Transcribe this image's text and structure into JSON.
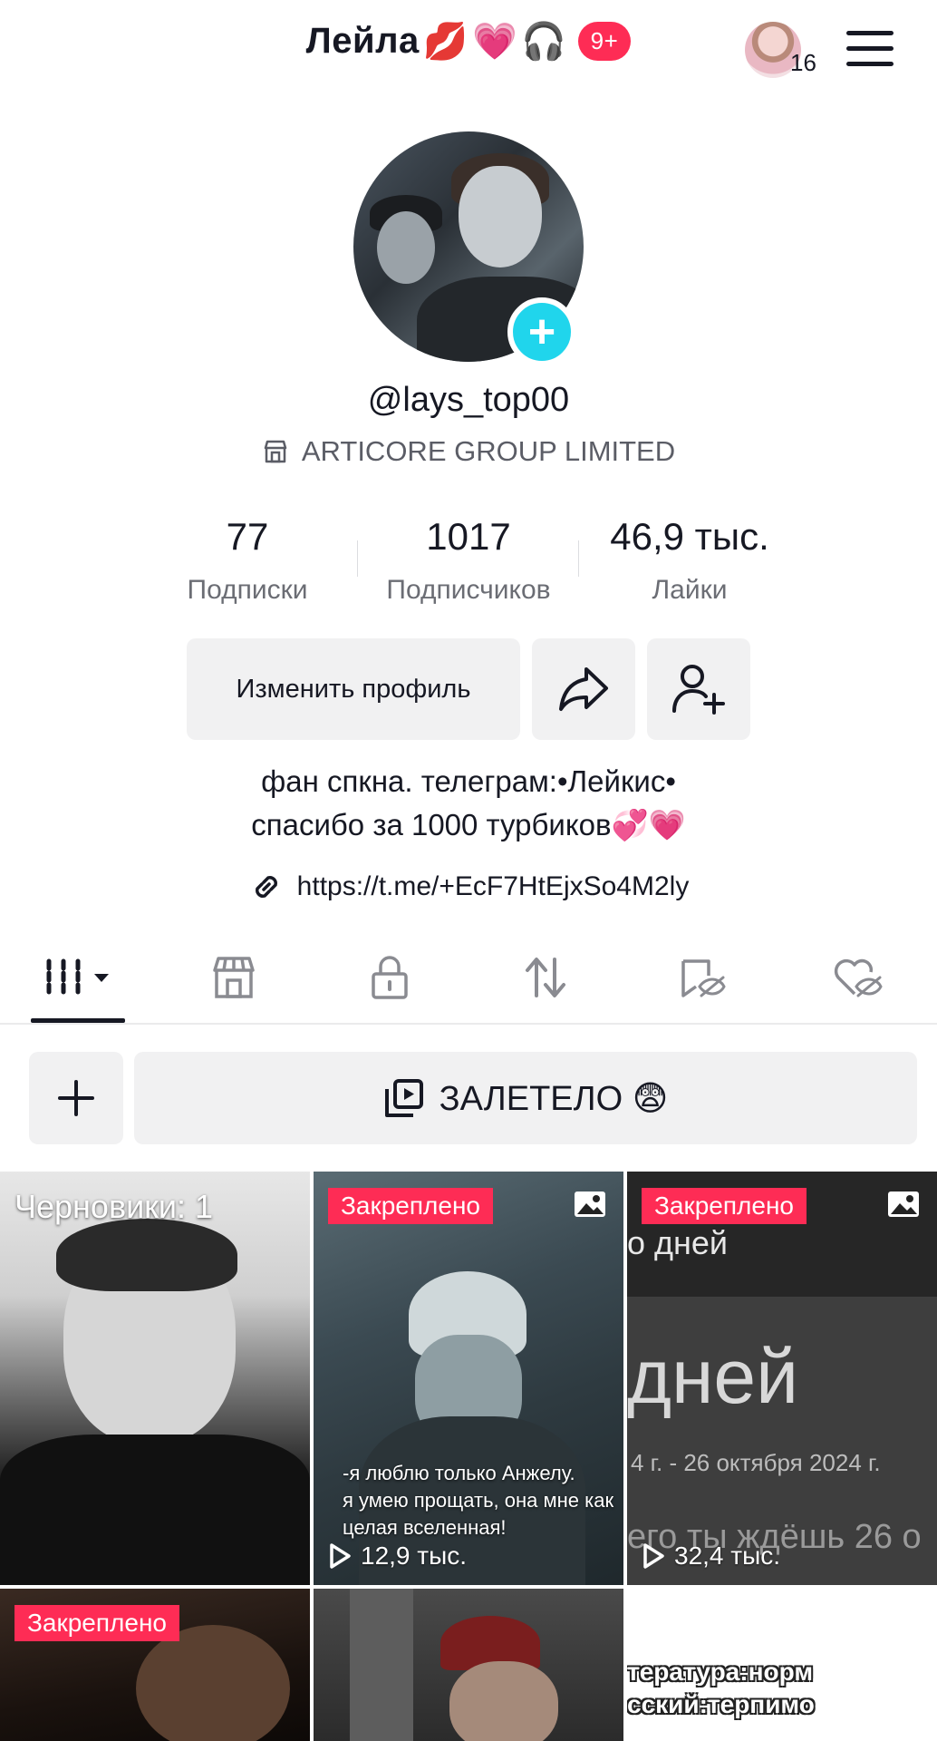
{
  "header": {
    "display_name": "Лейла",
    "name_emojis": [
      "💋",
      "💗",
      "🎧"
    ],
    "notification_badge": "9+",
    "friends_count": "16"
  },
  "profile": {
    "username": "@lays_top00",
    "company": "ARTICORE GROUP LIMITED"
  },
  "stats": [
    {
      "value": "77",
      "label": "Подписки"
    },
    {
      "value": "1017",
      "label": "Подписчиков"
    },
    {
      "value": "46,9 тыс.",
      "label": "Лайки"
    }
  ],
  "actions": {
    "edit_profile": "Изменить профиль"
  },
  "bio": {
    "line1": "фан спкна. телеграм:•Лейкис•",
    "line2": "спасибо за 1000 турбиков💞💗",
    "link": "https://t.me/+EcF7HtEjxSo4M2ly"
  },
  "tabs": [
    "videos",
    "shop",
    "private",
    "reposts",
    "favorites",
    "liked"
  ],
  "playlist": {
    "title": "ЗАЛЕТЕЛО 😨"
  },
  "grid": {
    "drafts_label": "Черновики: 1",
    "pinned_label": "Закреплено",
    "tile2_caption": [
      "-я люблю только Анжелу.",
      "я умею прощать, она мне как",
      "целая вселенная!"
    ],
    "tile2_views": "12,9 тыс.",
    "tile3_top": "о дней",
    "tile3_big": "дней",
    "tile3_date": "4 г. - 26 октября 2024 г.",
    "tile3_bottom": "его ты ждёшь 26 о",
    "tile3_views": "32,4 тыс.",
    "tile6_line1": "тература:норм",
    "tile6_line2": "сский:терпимо"
  },
  "colors": {
    "accent": "#fe2c55",
    "avatar_add": "#20d5ec",
    "button_bg": "#f1f1f2"
  }
}
